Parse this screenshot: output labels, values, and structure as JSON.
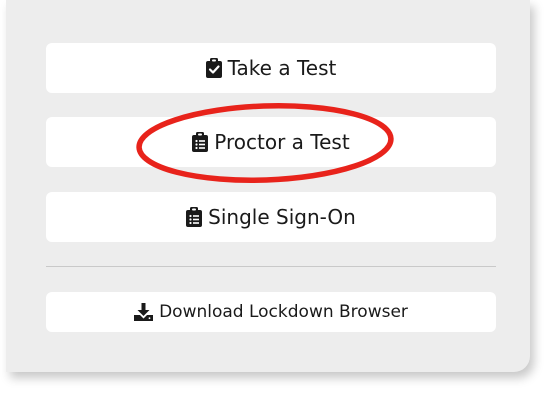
{
  "buttons": {
    "take_test": {
      "label": "Take a Test",
      "icon": "clipboard-check-icon"
    },
    "proctor_test": {
      "label": "Proctor a Test",
      "icon": "clipboard-list-icon"
    },
    "single_sign_on": {
      "label": "Single Sign-On",
      "icon": "clipboard-list-icon"
    },
    "download_lockdown": {
      "label": "Download Lockdown Browser",
      "icon": "download-icon"
    }
  },
  "colors": {
    "panel_bg": "#ededed",
    "button_bg": "#ffffff",
    "text": "#1a1a1a",
    "annotation": "#e8231b"
  },
  "annotation": {
    "shape": "ellipse",
    "target": "proctor_test"
  }
}
